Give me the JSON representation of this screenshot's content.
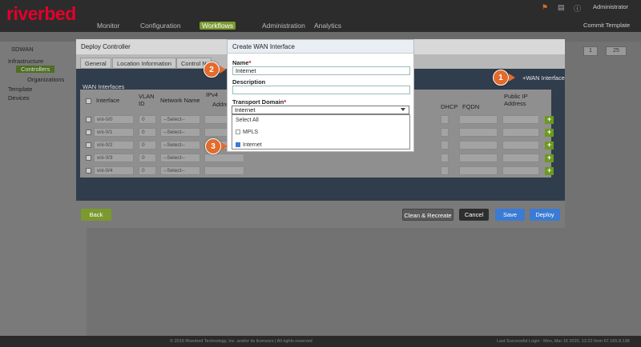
{
  "app": {
    "logo": "riverbed",
    "user": "Administrator",
    "commit": "Commit Template",
    "nav": [
      "Monitor",
      "Configuration",
      "Workflows",
      "Administration",
      "Analytics"
    ],
    "active_nav": "Workflows"
  },
  "sidebar": {
    "root": "SDWAN",
    "items": [
      "Infrastructure",
      "Controllers",
      "Organizations",
      "Template",
      "Devices"
    ]
  },
  "pager": {
    "page": "1",
    "size": "25"
  },
  "modal": {
    "title": "Deploy Controller",
    "tabs": [
      "General",
      "Location Information",
      "Control N"
    ],
    "wan_link": "+WAN Interface",
    "wan_section": "WAN Interfaces",
    "columns": {
      "interface": "Interface",
      "vlan": "VLAN ID",
      "network": "Network Name",
      "ipv4": "IPv4",
      "address": "Address",
      "dhcp": "DHCP",
      "fqdn": "FQDN",
      "public_ip": "Public IP Address"
    },
    "rows": [
      {
        "iface": "vni-0/0",
        "vlan": "0",
        "network": "--Select--"
      },
      {
        "iface": "vni-0/1",
        "vlan": "0",
        "network": "--Select--"
      },
      {
        "iface": "vni-0/2",
        "vlan": "0",
        "network": "--Select--"
      },
      {
        "iface": "vni-0/3",
        "vlan": "0",
        "network": "--Select--"
      },
      {
        "iface": "vni-0/4",
        "vlan": "0",
        "network": "--Select--"
      }
    ],
    "buttons": {
      "back": "Back",
      "clean": "Clean & Recreate",
      "cancel": "Cancel",
      "save": "Save",
      "deploy": "Deploy"
    }
  },
  "dialog": {
    "title": "Create WAN Interface",
    "name_label": "Name",
    "name_value": "Internet",
    "description_label": "Description",
    "description_value": "",
    "transport_label": "Transport Domain",
    "transport_value": "Internet",
    "options": [
      {
        "label": "Select All",
        "checked": false
      },
      {
        "label": "MPLS",
        "checked": false
      },
      {
        "label": "Internet",
        "checked": true
      }
    ]
  },
  "callouts": [
    "1",
    "2",
    "3"
  ],
  "footer": {
    "copyright": "© 2019 Riverbed Technology, Inc. and/or its licensors | All rights reserved",
    "last_login": "Last Successful Login : Mon, Mar 16 2020, 12:22 from 67.165.8.138"
  },
  "colors": {
    "brand": "#e4002b",
    "callout": "#e36b2c",
    "accent_green": "#6b9a1f",
    "save_blue": "#3a7bd5"
  }
}
